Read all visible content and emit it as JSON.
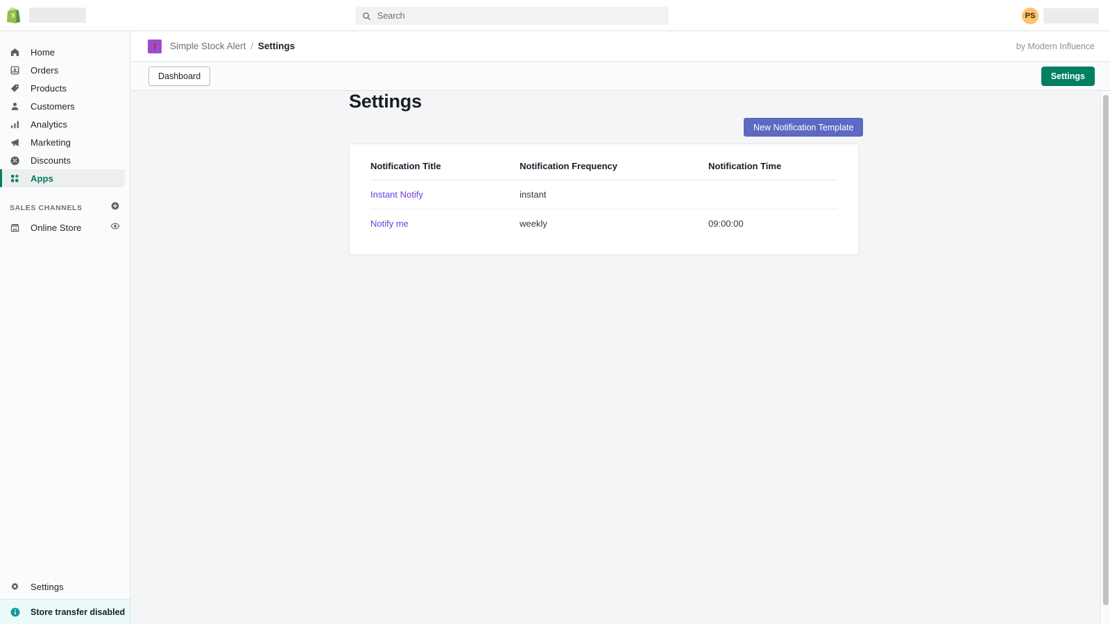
{
  "topbar": {
    "logo_icon": "shopify-bag-icon",
    "search": {
      "icon": "search-icon",
      "placeholder": "Search",
      "value": ""
    },
    "avatar_initials": "PS"
  },
  "sidebar": {
    "items": [
      {
        "label": "Home",
        "icon": "home-icon",
        "active": false
      },
      {
        "label": "Orders",
        "icon": "orders-inbox-icon",
        "active": false
      },
      {
        "label": "Products",
        "icon": "product-tag-icon",
        "active": false
      },
      {
        "label": "Customers",
        "icon": "person-icon",
        "active": false
      },
      {
        "label": "Analytics",
        "icon": "bar-chart-icon",
        "active": false
      },
      {
        "label": "Marketing",
        "icon": "megaphone-icon",
        "active": false
      },
      {
        "label": "Discounts",
        "icon": "discount-badge-icon",
        "active": false
      },
      {
        "label": "Apps",
        "icon": "apps-grid-plus-icon",
        "active": true
      }
    ],
    "sales_channels": {
      "title": "SALES CHANNELS",
      "add_icon": "plus-circle-icon",
      "channels": [
        {
          "label": "Online Store",
          "icon": "storefront-icon",
          "trailing_icon": "eye-icon"
        }
      ]
    },
    "settings": {
      "label": "Settings",
      "icon": "gear-icon"
    },
    "notice": {
      "label": "Store transfer disabled",
      "icon": "info-circle-icon",
      "accent": "#0f9b9b"
    }
  },
  "app_header": {
    "app_icon": "alert-exclamation-app-icon",
    "app_name": "Simple Stock Alert",
    "separator": "/",
    "current_page": "Settings",
    "author": "by Modern Influence"
  },
  "app_toolbar": {
    "dashboard_label": "Dashboard",
    "settings_label": "Settings",
    "primary_color": "#008060"
  },
  "main": {
    "page_title": "Settings",
    "new_template_label": "New Notification Template",
    "new_template_color": "#5c6ac4",
    "link_color": "#6b3fe0",
    "table": {
      "columns": [
        "Notification Title",
        "Notification Frequency",
        "Notification Time"
      ],
      "rows": [
        {
          "title": "Instant Notify",
          "frequency": "instant",
          "time": ""
        },
        {
          "title": "Notify me",
          "frequency": "weekly",
          "time": "09:00:00"
        }
      ]
    }
  }
}
